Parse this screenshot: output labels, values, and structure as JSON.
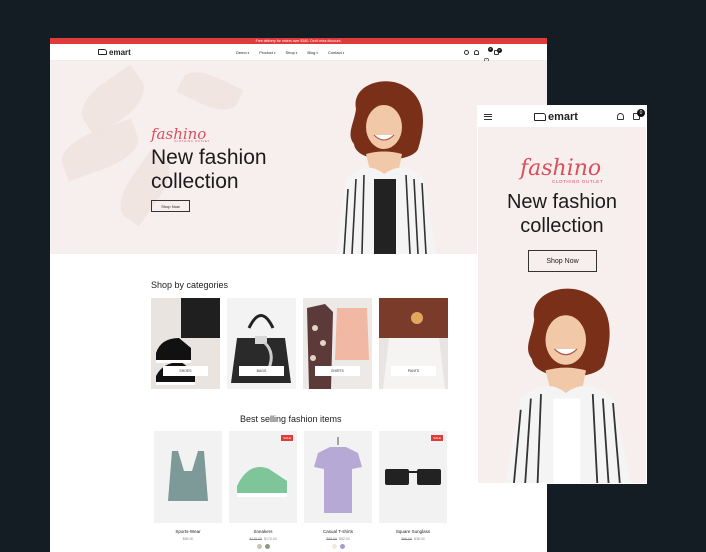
{
  "promo": {
    "text": "Free delivery for orders over $180. Don't miss discount."
  },
  "nav": {
    "logo": "emart",
    "menu": [
      {
        "label": "Demo"
      },
      {
        "label": "Product"
      },
      {
        "label": "Shop"
      },
      {
        "label": "Blog"
      },
      {
        "label": "Contact"
      }
    ],
    "wishlist_count": "0",
    "cart_count": "0"
  },
  "hero": {
    "brand": "fashino",
    "brand_sub": "CLOTHING OUTLET",
    "title": "New fashion collection",
    "button": "Shop Now"
  },
  "categories": {
    "title": "Shop by categories",
    "items": [
      {
        "label": "SHOES"
      },
      {
        "label": "BAGS"
      },
      {
        "label": "SHIRTS"
      },
      {
        "label": "PANTS"
      }
    ]
  },
  "products": {
    "title": "Best selling fashion items",
    "items": [
      {
        "name": "Sports-Wear",
        "old_price": "",
        "price": "$59.00",
        "sale": ""
      },
      {
        "name": "Sneakers",
        "old_price": "$178.00",
        "price": "$170.00",
        "sale": "SALE"
      },
      {
        "name": "Casual T-shirts",
        "old_price": "$58.00",
        "price": "$52.00",
        "sale": ""
      },
      {
        "name": "Square Sunglass",
        "old_price": "$56.00",
        "price": "$38.00",
        "sale": "SALE"
      }
    ]
  },
  "mobile": {
    "logo": "emart",
    "cart_count": "0",
    "brand": "fashino",
    "brand_sub": "CLOTHING OUTLET",
    "title": "New fashion collection",
    "button": "Shop Now"
  },
  "colors": {
    "accent": "#e03b3b",
    "brand_script": "#d94f5c",
    "hero_bg": "#f7efed",
    "page_bg": "#141d23"
  }
}
